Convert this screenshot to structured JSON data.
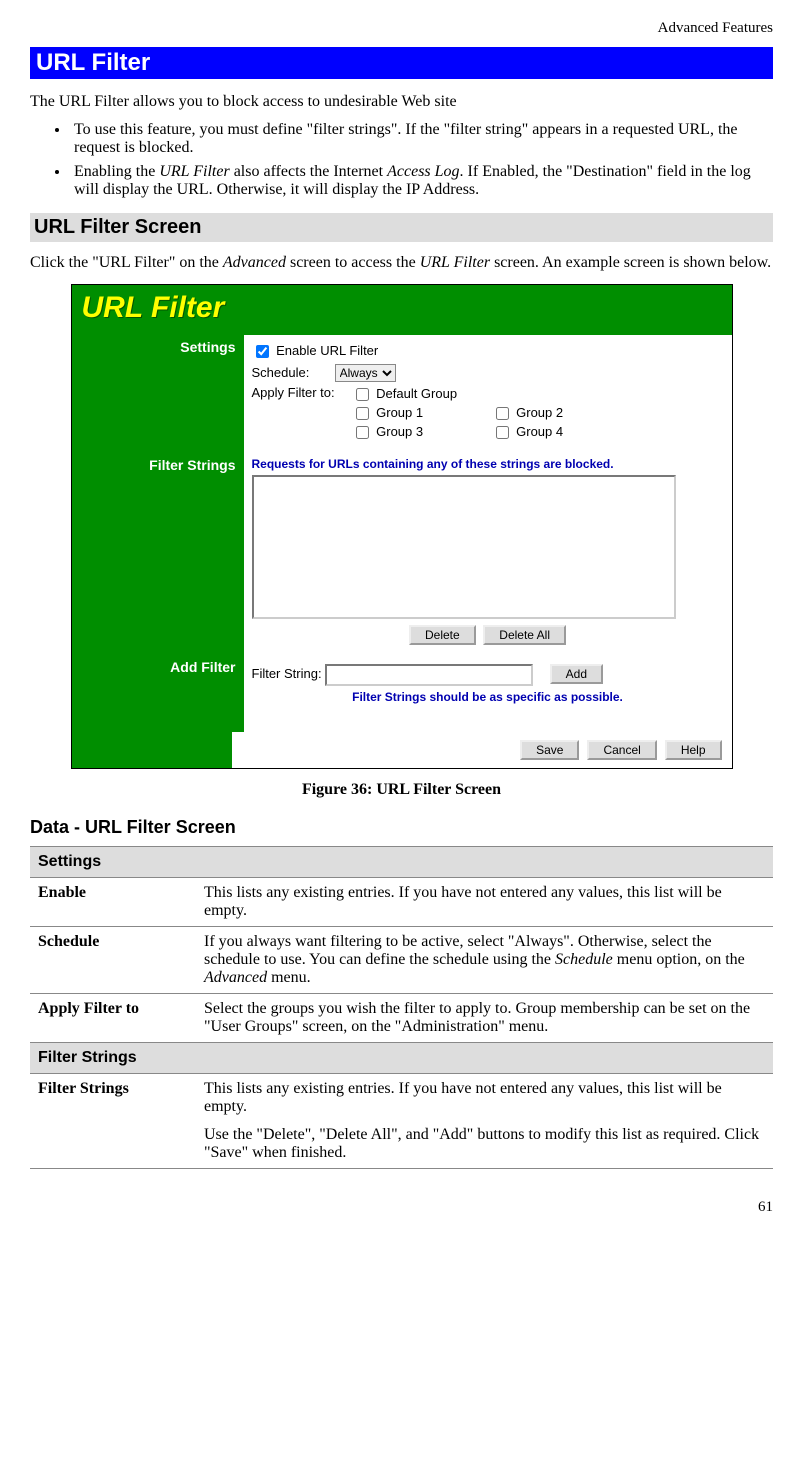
{
  "header": {
    "right": "Advanced Features"
  },
  "titleBar": "URL Filter",
  "intro": "The URL Filter allows you to block access to undesirable Web site",
  "bullets": [
    {
      "pre": "To use this feature, you must define \"filter strings\". If the \"filter string\" appears in a requested URL, the request is blocked.",
      "i1": "",
      "mid": "",
      "i2": "",
      "post": ""
    },
    {
      "pre": "Enabling the ",
      "i1": "URL Filter",
      "mid": " also affects the Internet ",
      "i2": "Access Log",
      "post": ". If Enabled, the \"Destination\" field in the log will display the URL. Otherwise, it will display the IP Address."
    }
  ],
  "section1": "URL Filter Screen",
  "para1": {
    "pre": "Click the \"URL Filter\" on the ",
    "i1": "Advanced",
    "mid": " screen to access the ",
    "i2": "URL Filter",
    "post": " screen. An example screen is shown below."
  },
  "screenshot": {
    "title": "URL Filter",
    "settingsLabel": "Settings",
    "enableLabel": "Enable URL Filter",
    "scheduleLabel": "Schedule:",
    "scheduleValue": "Always",
    "applyLabel": "Apply Filter to:",
    "defaultGroup": "Default Group",
    "group1": "Group 1",
    "group2": "Group 2",
    "group3": "Group 3",
    "group4": "Group 4",
    "filterStringsLabel": "Filter Strings",
    "filterStringsNote": "Requests for URLs containing any of these strings are blocked.",
    "deleteBtn": "Delete",
    "deleteAllBtn": "Delete All",
    "addFilterLabel": "Add Filter",
    "filterStringInput": "Filter String:",
    "addBtn": "Add",
    "addNote": "Filter Strings should be as specific as possible.",
    "saveBtn": "Save",
    "cancelBtn": "Cancel",
    "helpBtn": "Help"
  },
  "caption": "Figure 36: URL Filter Screen",
  "h3": "Data - URL Filter Screen",
  "table": {
    "sec1": "Settings",
    "r1": {
      "label": "Enable",
      "val": "This lists any existing entries. If you have not entered any values, this list will be empty."
    },
    "r2": {
      "label": "Schedule",
      "pre": "If you always want filtering to be active, select \"Always\". Otherwise, select the schedule to use. You can define the schedule using the ",
      "i1": "Schedule",
      "mid": " menu option, on the ",
      "i2": "Advanced",
      "post": " menu."
    },
    "r3": {
      "label": "Apply Filter to",
      "val": "Select the groups you wish the filter to apply to. Group membership can be set on the \"User Groups\" screen, on the \"Administration\" menu."
    },
    "sec2": "Filter Strings",
    "r4": {
      "label": "Filter Strings",
      "p1": "This lists any existing entries. If you have not entered any values, this list will be empty.",
      "p2": "Use the \"Delete\", \"Delete All\", and \"Add\" buttons to modify this list as required.  Click \"Save\" when finished."
    }
  },
  "pageNum": "61"
}
